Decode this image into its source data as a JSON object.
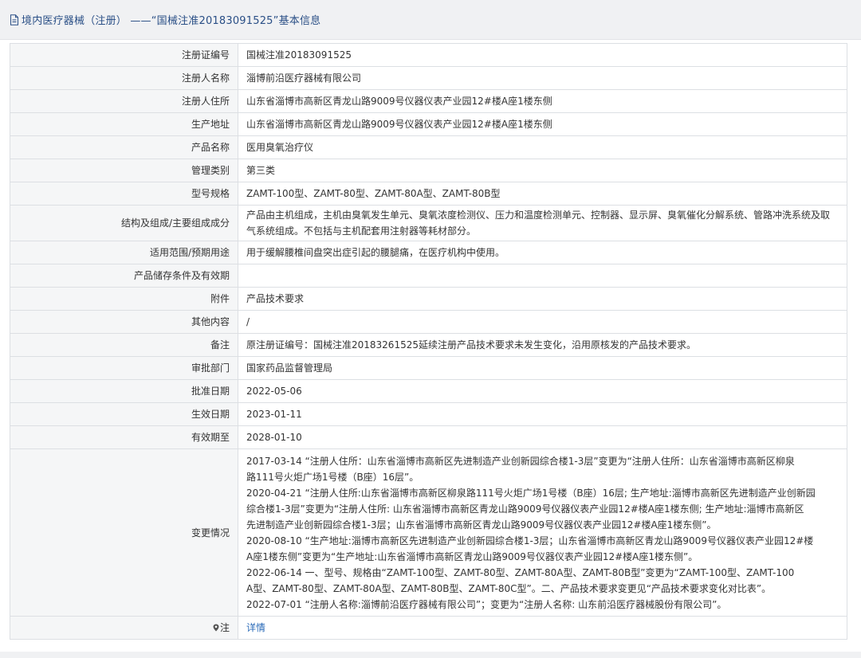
{
  "header": {
    "title": "境内医疗器械（注册） ——“国械注准20183091525”基本信息"
  },
  "fields": {
    "reg_no": {
      "label": "注册证编号",
      "value": "国械注准20183091525"
    },
    "registrant": {
      "label": "注册人名称",
      "value": "淄博前沿医疗器械有限公司"
    },
    "registrant_addr": {
      "label": "注册人住所",
      "value": "山东省淄博市高新区青龙山路9009号仪器仪表产业园12#楼A座1楼东侧"
    },
    "prod_addr": {
      "label": "生产地址",
      "value": "山东省淄博市高新区青龙山路9009号仪器仪表产业园12#楼A座1楼东侧"
    },
    "product_name": {
      "label": "产品名称",
      "value": "医用臭氧治疗仪"
    },
    "category": {
      "label": "管理类别",
      "value": "第三类"
    },
    "models": {
      "label": "型号规格",
      "value": "ZAMT-100型、ZAMT-80型、ZAMT-80A型、ZAMT-80B型"
    },
    "structure": {
      "label": "结构及组成/主要组成成分",
      "value": "产品由主机组成，主机由臭氧发生单元、臭氧浓度检测仪、压力和温度检测单元、控制器、显示屏、臭氧催化分解系统、管路冲洗系统及取气系统组成。不包括与主机配套用注射器等耗材部分。"
    },
    "scope": {
      "label": "适用范围/预期用途",
      "value": "用于缓解腰椎间盘突出症引起的腰腿痛，在医疗机构中使用。"
    },
    "storage": {
      "label": "产品储存条件及有效期",
      "value": ""
    },
    "attachment": {
      "label": "附件",
      "value": "产品技术要求"
    },
    "other": {
      "label": "其他内容",
      "value": "/"
    },
    "remark": {
      "label": "备注",
      "value": "原注册证编号：国械注准20183261525延续注册产品技术要求未发生变化，沿用原核发的产品技术要求。"
    },
    "dept": {
      "label": "审批部门",
      "value": "国家药品监督管理局"
    },
    "approval_date": {
      "label": "批准日期",
      "value": "2022-05-06"
    },
    "effective_date": {
      "label": "生效日期",
      "value": "2023-01-11"
    },
    "expiry_date": {
      "label": "有效期至",
      "value": "2028-01-10"
    },
    "changes": {
      "label": "变更情况",
      "lines": [
        "2017-03-14 “注册人住所：山东省淄博市高新区先进制造产业创新园综合楼1-3层”变更为“注册人住所：山东省淄博市高新区柳泉",
        "路111号火炬广场1号楼（B座）16层”。",
        "2020-04-21 “注册人住所:山东省淄博市高新区柳泉路111号火炬广场1号楼（B座）16层; 生产地址:淄博市高新区先进制造产业创新园",
        "综合楼1-3层”变更为“注册人住所: 山东省淄博市高新区青龙山路9009号仪器仪表产业园12#楼A座1楼东侧; 生产地址:淄博市高新区",
        "先进制造产业创新园综合楼1-3层；山东省淄博市高新区青龙山路9009号仪器仪表产业园12#楼A座1楼东侧”。",
        "2020-08-10 “生产地址:淄博市高新区先进制造产业创新园综合楼1-3层；山东省淄博市高新区青龙山路9009号仪器仪表产业园12#楼",
        "A座1楼东侧”变更为“生产地址:山东省淄博市高新区青龙山路9009号仪器仪表产业园12#楼A座1楼东侧”。",
        "2022-06-14 一、型号、规格由“ZAMT-100型、ZAMT-80型、ZAMT-80A型、ZAMT-80B型”变更为“ZAMT-100型、ZAMT-100",
        "A型、ZAMT-80型、ZAMT-80A型、ZAMT-80B型、ZAMT-80C型”。二、产品技术要求变更见“产品技术要求变化对比表”。",
        "2022-07-01 “注册人名称:淄博前沿医疗器械有限公司”；变更为“注册人名称: 山东前沿医疗器械股份有限公司”。"
      ]
    },
    "note": {
      "label": "注",
      "value": "详情"
    }
  },
  "colors": {
    "title": "#2a4f86",
    "link": "#2a6ab8",
    "label_bg": "#f5f6f7",
    "border": "#dcdfe3"
  },
  "icons": {
    "header": "document-icon",
    "note": "location-pin-icon"
  }
}
